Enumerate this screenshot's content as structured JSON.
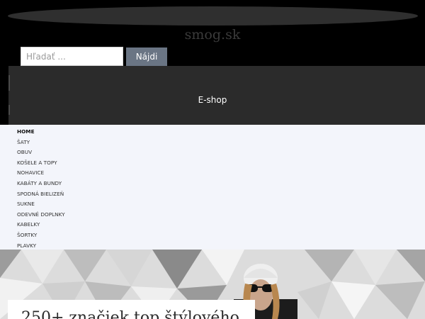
{
  "header": {
    "site_title": "smog.sk",
    "search_placeholder": "Hľadať ...",
    "search_button": "Nájdi",
    "eshop_label": "E-shop"
  },
  "nav": {
    "items": [
      {
        "label": "HOME",
        "active": true
      },
      {
        "label": "ŠATY"
      },
      {
        "label": "OBUV"
      },
      {
        "label": "KOŠELE A TOPY"
      },
      {
        "label": "NOHAVICE"
      },
      {
        "label": "KABÁTY A BUNDY"
      },
      {
        "label": "SPODNÁ BIELIZEŇ"
      },
      {
        "label": "SUKNE"
      },
      {
        "label": "ODEVNÉ DOPLNKY"
      },
      {
        "label": "KABELKY"
      },
      {
        "label": "ŠORTKY"
      },
      {
        "label": "PLAVKY"
      }
    ]
  },
  "hero": {
    "headline": "250+ značiek top štýlového"
  },
  "colors": {
    "page_bg": "#000000",
    "bar_bg": "#2b2b2b",
    "nav_bg": "#f3f5fb",
    "button_bg": "#6a7584"
  },
  "icons": {
    "hero_image": "model-with-sunglasses-and-beanie-image"
  }
}
